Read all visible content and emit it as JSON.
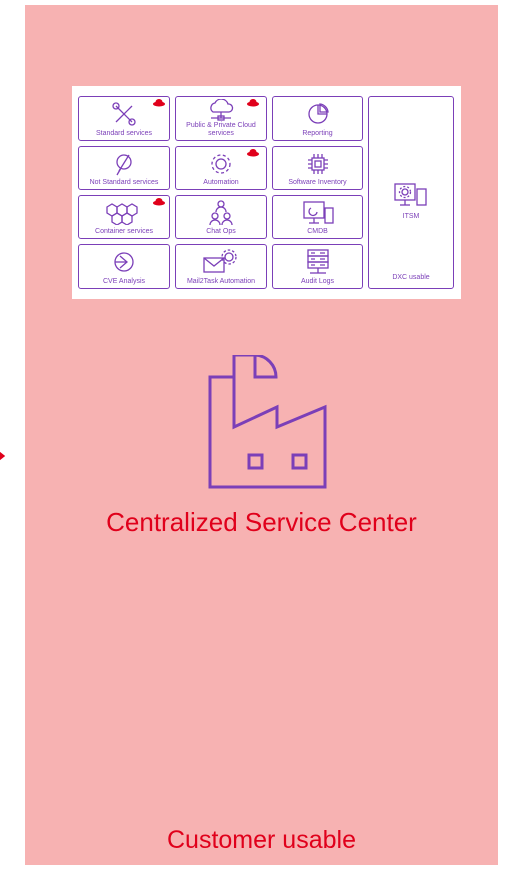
{
  "tiles": {
    "standard": "Standard services",
    "cloud": "Public & Private Cloud services",
    "reporting": "Reporting",
    "not_standard": "Not Standard services",
    "automation": "Automation",
    "software_inventory": "Software Inventory",
    "container": "Container services",
    "chatops": "Chat Ops",
    "cmdb": "CMDB",
    "cve": "CVE Analysis",
    "mail2task": "Mail2Task Automation",
    "audit": "Audit Logs",
    "itsm": "ITSM",
    "dxc": "DXC usable"
  },
  "title": "Centralized Service Center",
  "footer": "Customer usable",
  "colors": {
    "panel": "#f7b2b2",
    "accent_red": "#e0001b",
    "purple": "#7b3fb8",
    "redhat": "#e0001b"
  },
  "icons": [
    "tools-icon",
    "cloud-network-icon",
    "pie-chart-icon",
    "wrench-cross-icon",
    "gear-icon",
    "chip-icon",
    "hexagon-cluster-icon",
    "people-icon",
    "monitor-icon",
    "shield-icon",
    "mail-gear-icon",
    "server-icon",
    "itsm-gear-devices-icon",
    "factory-icon",
    "chevron-right-icon",
    "redhat-logo-icon"
  ]
}
